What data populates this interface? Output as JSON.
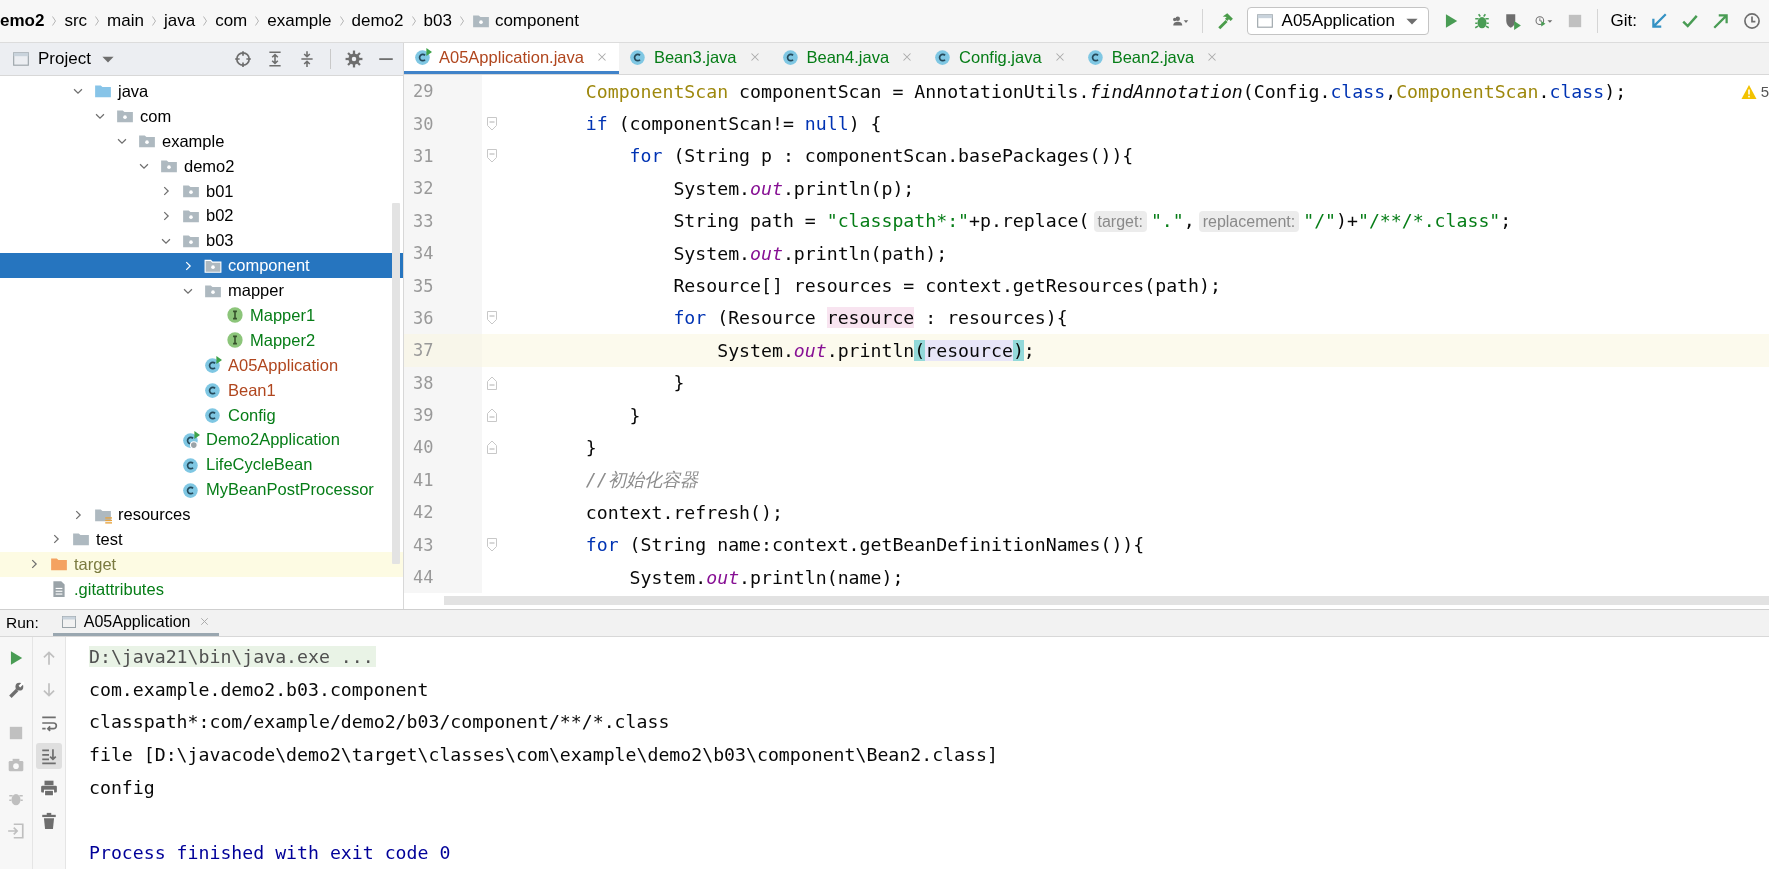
{
  "breadcrumbs": [
    {
      "kind": "project",
      "label": "emo2"
    },
    {
      "kind": "dir",
      "label": "src"
    },
    {
      "kind": "dir",
      "label": "main"
    },
    {
      "kind": "dir",
      "label": "java"
    },
    {
      "kind": "dir",
      "label": "com"
    },
    {
      "kind": "dir",
      "label": "example"
    },
    {
      "kind": "dir",
      "label": "demo2"
    },
    {
      "kind": "dir",
      "label": "b03"
    },
    {
      "kind": "package",
      "label": "component"
    }
  ],
  "toolbar": [
    {
      "kind": "users",
      "disabled": false
    },
    {
      "kind": "build",
      "disabled": false
    },
    {
      "kind": "run-config",
      "label": "A05Application"
    },
    {
      "kind": "run",
      "disabled": false
    },
    {
      "kind": "debug",
      "disabled": false
    },
    {
      "kind": "coverage",
      "disabled": false
    },
    {
      "kind": "profile",
      "disabled": false
    },
    {
      "kind": "stop",
      "disabled": true
    },
    {
      "kind": "git-label",
      "label": "Git:"
    },
    {
      "kind": "update",
      "disabled": false
    },
    {
      "kind": "commit",
      "disabled": false
    },
    {
      "kind": "push",
      "disabled": false
    },
    {
      "kind": "history",
      "disabled": false
    }
  ],
  "project_panel": {
    "title": "Project"
  },
  "tree": [
    {
      "children": [
        {
          "children": [
            {
              "label": "java",
              "kind": "src-folder",
              "expanded": true,
              "selected": false,
              "ignored": false,
              "color": "#000000",
              "children": [
                {
                  "label": "com",
                  "kind": "package",
                  "expanded": true,
                  "selected": false,
                  "ignored": false,
                  "color": "#000000",
                  "children": [
                    {
                      "label": "example",
                      "kind": "package",
                      "expanded": true,
                      "selected": false,
                      "ignored": false,
                      "color": "#000000",
                      "children": [
                        {
                          "label": "demo2",
                          "kind": "package",
                          "expanded": true,
                          "selected": false,
                          "ignored": false,
                          "color": "#000000",
                          "children": [
                            {
                              "label": "b01",
                              "kind": "package",
                              "expanded": false,
                              "selected": false,
                              "ignored": false,
                              "color": "#000000"
                            },
                            {
                              "label": "b02",
                              "kind": "package",
                              "expanded": false,
                              "selected": false,
                              "ignored": false,
                              "color": "#000000"
                            },
                            {
                              "label": "b03",
                              "kind": "package",
                              "expanded": true,
                              "selected": false,
                              "ignored": false,
                              "color": "#000000",
                              "children": [
                                {
                                  "label": "component",
                                  "kind": "package",
                                  "expanded": false,
                                  "selected": true,
                                  "ignored": false
                                },
                                {
                                  "label": "mapper",
                                  "kind": "package",
                                  "expanded": true,
                                  "selected": false,
                                  "ignored": false,
                                  "color": "#000000",
                                  "children": [
                                    {
                                      "label": "Mapper1",
                                      "kind": "interface",
                                      "selected": false,
                                      "ignored": false,
                                      "color": "#067d17"
                                    },
                                    {
                                      "label": "Mapper2",
                                      "kind": "interface",
                                      "selected": false,
                                      "ignored": false,
                                      "color": "#067d17"
                                    }
                                  ]
                                },
                                {
                                  "label": "A05Application",
                                  "kind": "class-main",
                                  "selected": false,
                                  "ignored": false,
                                  "color": "#b0461e"
                                },
                                {
                                  "label": "Bean1",
                                  "kind": "class",
                                  "selected": false,
                                  "ignored": false,
                                  "color": "#b0461e"
                                },
                                {
                                  "label": "Config",
                                  "kind": "class",
                                  "selected": false,
                                  "ignored": false,
                                  "color": "#067d17"
                                }
                              ]
                            },
                            {
                              "label": "Demo2Application",
                              "kind": "spring-main",
                              "selected": false,
                              "ignored": false,
                              "color": "#067d17"
                            },
                            {
                              "label": "LifeCycleBean",
                              "kind": "class",
                              "selected": false,
                              "ignored": false,
                              "color": "#067d17"
                            },
                            {
                              "label": "MyBeanPostProcessor",
                              "kind": "class",
                              "selected": false,
                              "ignored": false,
                              "color": "#067d17"
                            }
                          ]
                        }
                      ]
                    }
                  ]
                }
              ]
            },
            {
              "label": "resources",
              "kind": "resources",
              "expanded": false,
              "selected": false,
              "ignored": false,
              "color": "#000000"
            }
          ]
        },
        {
          "label": "test",
          "kind": "folder",
          "expanded": false,
          "selected": false,
          "ignored": false,
          "color": "#000000"
        }
      ]
    },
    {
      "label": "target",
      "kind": "excluded-folder",
      "expanded": false,
      "selected": false,
      "ignored": true,
      "color": "#7a7a40"
    },
    {
      "label": ".gitattributes",
      "kind": "file",
      "selected": false,
      "ignored": false,
      "color": "#067d17"
    }
  ],
  "editor_tabs": [
    {
      "label": "A05Application.java",
      "kind": "class-main",
      "color": "#b0461e",
      "selected": true
    },
    {
      "label": "Bean3.java",
      "kind": "class",
      "color": "#067d17",
      "selected": false
    },
    {
      "label": "Bean4.java",
      "kind": "class",
      "color": "#067d17",
      "selected": false
    },
    {
      "label": "Config.java",
      "kind": "class",
      "color": "#067d17",
      "selected": false
    },
    {
      "label": "Bean2.java",
      "kind": "class",
      "color": "#067d17",
      "selected": false
    }
  ],
  "inspection": {
    "count": "5"
  },
  "code_lines": [
    {
      "number": "29",
      "kind": "plain",
      "current": false,
      "tokens": [
        {
          "kind": "type",
          "text": "    ComponentScan"
        },
        {
          "kind": "plain",
          "text": " componentScan = AnnotationUtils."
        },
        {
          "kind": "method",
          "text": "findAnnotation"
        },
        {
          "kind": "plain",
          "text": "(Config."
        },
        {
          "kind": "kw",
          "text": "class"
        },
        {
          "kind": "plain",
          "text": ","
        },
        {
          "kind": "type",
          "text": "ComponentScan"
        },
        {
          "kind": "plain",
          "text": "."
        },
        {
          "kind": "kw",
          "text": "class"
        },
        {
          "kind": "plain",
          "text": ");"
        }
      ]
    },
    {
      "number": "30",
      "kind": "fold-start",
      "current": false,
      "tokens": [
        {
          "kind": "kw",
          "text": "    if"
        },
        {
          "kind": "plain",
          "text": " (componentScan!= "
        },
        {
          "kind": "kw",
          "text": "null"
        },
        {
          "kind": "plain",
          "text": ") {"
        }
      ]
    },
    {
      "number": "31",
      "kind": "fold-start",
      "current": false,
      "tokens": [
        {
          "kind": "kw",
          "text": "        for"
        },
        {
          "kind": "plain",
          "text": " (String p : componentScan.basePackages()){"
        }
      ]
    },
    {
      "number": "32",
      "kind": "plain",
      "current": false,
      "tokens": [
        {
          "kind": "plain",
          "text": "            System."
        },
        {
          "kind": "field",
          "text": "out"
        },
        {
          "kind": "plain",
          "text": ".println(p);"
        }
      ]
    },
    {
      "number": "33",
      "kind": "plain",
      "current": false,
      "tokens": [
        {
          "kind": "plain",
          "text": "            String path = "
        },
        {
          "kind": "str",
          "text": "\"classpath*:\""
        },
        {
          "kind": "plain",
          "text": "+p.replace("
        },
        {
          "kind": "hint",
          "text": "target:"
        },
        {
          "kind": "str",
          "text": "\".\""
        },
        {
          "kind": "plain",
          "text": ","
        },
        {
          "kind": "hint",
          "text": "replacement:"
        },
        {
          "kind": "str",
          "text": "\"/\""
        },
        {
          "kind": "plain",
          "text": ")+"
        },
        {
          "kind": "str",
          "text": "\"/**/*.class\""
        },
        {
          "kind": "plain",
          "text": ";"
        }
      ]
    },
    {
      "number": "34",
      "kind": "plain",
      "current": false,
      "tokens": [
        {
          "kind": "plain",
          "text": "            System."
        },
        {
          "kind": "field",
          "text": "out"
        },
        {
          "kind": "plain",
          "text": ".println(path);"
        }
      ]
    },
    {
      "number": "35",
      "kind": "plain",
      "current": false,
      "tokens": [
        {
          "kind": "plain",
          "text": "            Resource[] resources = context.getResources(path);"
        }
      ]
    },
    {
      "number": "36",
      "kind": "fold-start",
      "current": false,
      "tokens": [
        {
          "kind": "kw",
          "text": "            for"
        },
        {
          "kind": "plain",
          "text": " (Resource "
        },
        {
          "kind": "usage",
          "text": "resource"
        },
        {
          "kind": "plain",
          "text": " : resources){"
        }
      ]
    },
    {
      "number": "37",
      "kind": "plain",
      "current": true,
      "tokens": [
        {
          "kind": "plain",
          "text": "                System."
        },
        {
          "kind": "field",
          "text": "out"
        },
        {
          "kind": "plain",
          "text": ".println"
        },
        {
          "kind": "brace",
          "text": "("
        },
        {
          "kind": "read",
          "text": "resource"
        },
        {
          "kind": "brace",
          "text": ")"
        },
        {
          "kind": "plain",
          "text": ";"
        }
      ]
    },
    {
      "number": "38",
      "kind": "fold-end",
      "current": false,
      "tokens": [
        {
          "kind": "plain",
          "text": "            }"
        }
      ]
    },
    {
      "number": "39",
      "kind": "fold-end",
      "current": false,
      "tokens": [
        {
          "kind": "plain",
          "text": "        }"
        }
      ]
    },
    {
      "number": "40",
      "kind": "fold-end",
      "current": false,
      "tokens": [
        {
          "kind": "plain",
          "text": "    }"
        }
      ]
    },
    {
      "number": "41",
      "kind": "plain",
      "current": false,
      "tokens": [
        {
          "kind": "comment",
          "text": "    //初始化容器"
        }
      ]
    },
    {
      "number": "42",
      "kind": "plain",
      "current": false,
      "tokens": [
        {
          "kind": "plain",
          "text": "    context.refresh();"
        }
      ]
    },
    {
      "number": "43",
      "kind": "fold-start",
      "current": false,
      "tokens": [
        {
          "kind": "kw",
          "text": "    for"
        },
        {
          "kind": "plain",
          "text": " (String name:context.getBeanDefinitionNames()){"
        }
      ]
    },
    {
      "number": "44",
      "kind": "plain",
      "current": false,
      "tokens": [
        {
          "kind": "plain",
          "text": "        System."
        },
        {
          "kind": "field",
          "text": "out"
        },
        {
          "kind": "plain",
          "text": ".println(name);"
        }
      ]
    }
  ],
  "run_panel": {
    "label": "Run:",
    "tab": {
      "label": "A05Application",
      "selected": true
    },
    "left_tools": [
      {
        "kind": "rerun",
        "disabled": false
      },
      {
        "kind": "settings",
        "disabled": false
      },
      {
        "kind": "stop",
        "disabled": true
      },
      {
        "kind": "dump",
        "disabled": true
      },
      {
        "kind": "bug",
        "disabled": true
      },
      {
        "kind": "exit",
        "disabled": true
      }
    ],
    "right_tools": [
      {
        "kind": "up",
        "disabled": true,
        "on": false
      },
      {
        "kind": "down",
        "disabled": true,
        "on": false
      },
      {
        "kind": "wrap",
        "disabled": false,
        "on": false
      },
      {
        "kind": "scroll-end",
        "disabled": false,
        "on": true
      },
      {
        "kind": "print",
        "disabled": false,
        "on": false
      },
      {
        "kind": "trash",
        "disabled": false,
        "on": false
      }
    ],
    "console": [
      {
        "kind": "command",
        "text": "D:\\java21\\bin\\java.exe ..."
      },
      {
        "kind": "out",
        "text": "com.example.demo2.b03.component"
      },
      {
        "kind": "out",
        "text": "classpath*:com/example/demo2/b03/component/**/*.class"
      },
      {
        "kind": "out",
        "text": "file [D:\\javacode\\demo2\\target\\classes\\com\\example\\demo2\\b03\\component\\Bean2.class]"
      },
      {
        "kind": "out",
        "text": "config"
      },
      {
        "kind": "exit",
        "text": "Process finished with exit code 0"
      }
    ]
  }
}
